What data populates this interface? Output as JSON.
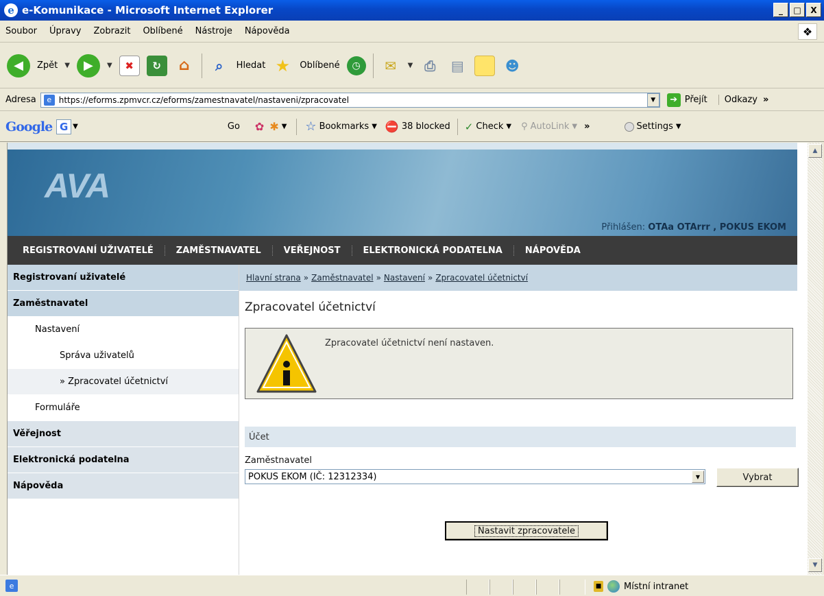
{
  "window": {
    "title": "e-Komunikace - Microsoft Internet Explorer"
  },
  "menu": [
    "Soubor",
    "Úpravy",
    "Zobrazit",
    "Oblíbené",
    "Nástroje",
    "Nápověda"
  ],
  "toolbar": {
    "back": "Zpět",
    "search": "Hledat",
    "favorites": "Oblíbené"
  },
  "address": {
    "label": "Adresa",
    "url": "https://eforms.zpmvcr.cz/eforms/zamestnavatel/nastaveni/zpracovatel",
    "go": "Přejít",
    "links": "Odkazy"
  },
  "google": {
    "logo": "Google",
    "go": "Go",
    "bookmarks": "Bookmarks",
    "blocked": "38 blocked",
    "check": "Check",
    "autolink": "AutoLink",
    "settings": "Settings"
  },
  "page": {
    "logo": "AVA",
    "logged_prefix": "Přihlášen:",
    "logged_user": "OTAa OTArrr , POKUS EKOM",
    "topnav": [
      "REGISTROVANÍ UŽIVATELÉ",
      "ZAMĚSTNAVATEL",
      "VEŘEJNOST",
      "ELEKTRONICKÁ PODATELNA",
      "NÁPOVĚDA"
    ],
    "sidebar": {
      "registered": "Registrovaní uživatelé",
      "employer": "Zaměstnavatel",
      "settings": "Nastavení",
      "user_admin": "Správa uživatelů",
      "processor": "» Zpracovatel účetnictví",
      "forms": "Formuláře",
      "public": "Věřejnost",
      "podatelna": "Elektronická podatelna",
      "help": "Nápověda"
    },
    "breadcrumb": [
      "Hlavní strana",
      "Zaměstnavatel",
      "Nastavení",
      "Zpracovatel účetnictví"
    ],
    "breadcrumb_sep": "»",
    "title": "Zpracovatel účetnictví",
    "alert": "Zpracovatel účetnictví není nastaven.",
    "section": "Účet",
    "employer_label": "Zaměstnavatel",
    "employer_value": "POKUS EKOM (IČ: 12312334)",
    "select_button": "Vybrat",
    "set_button": "Nastavit zpracovatele"
  },
  "status": {
    "zone": "Místní intranet"
  }
}
